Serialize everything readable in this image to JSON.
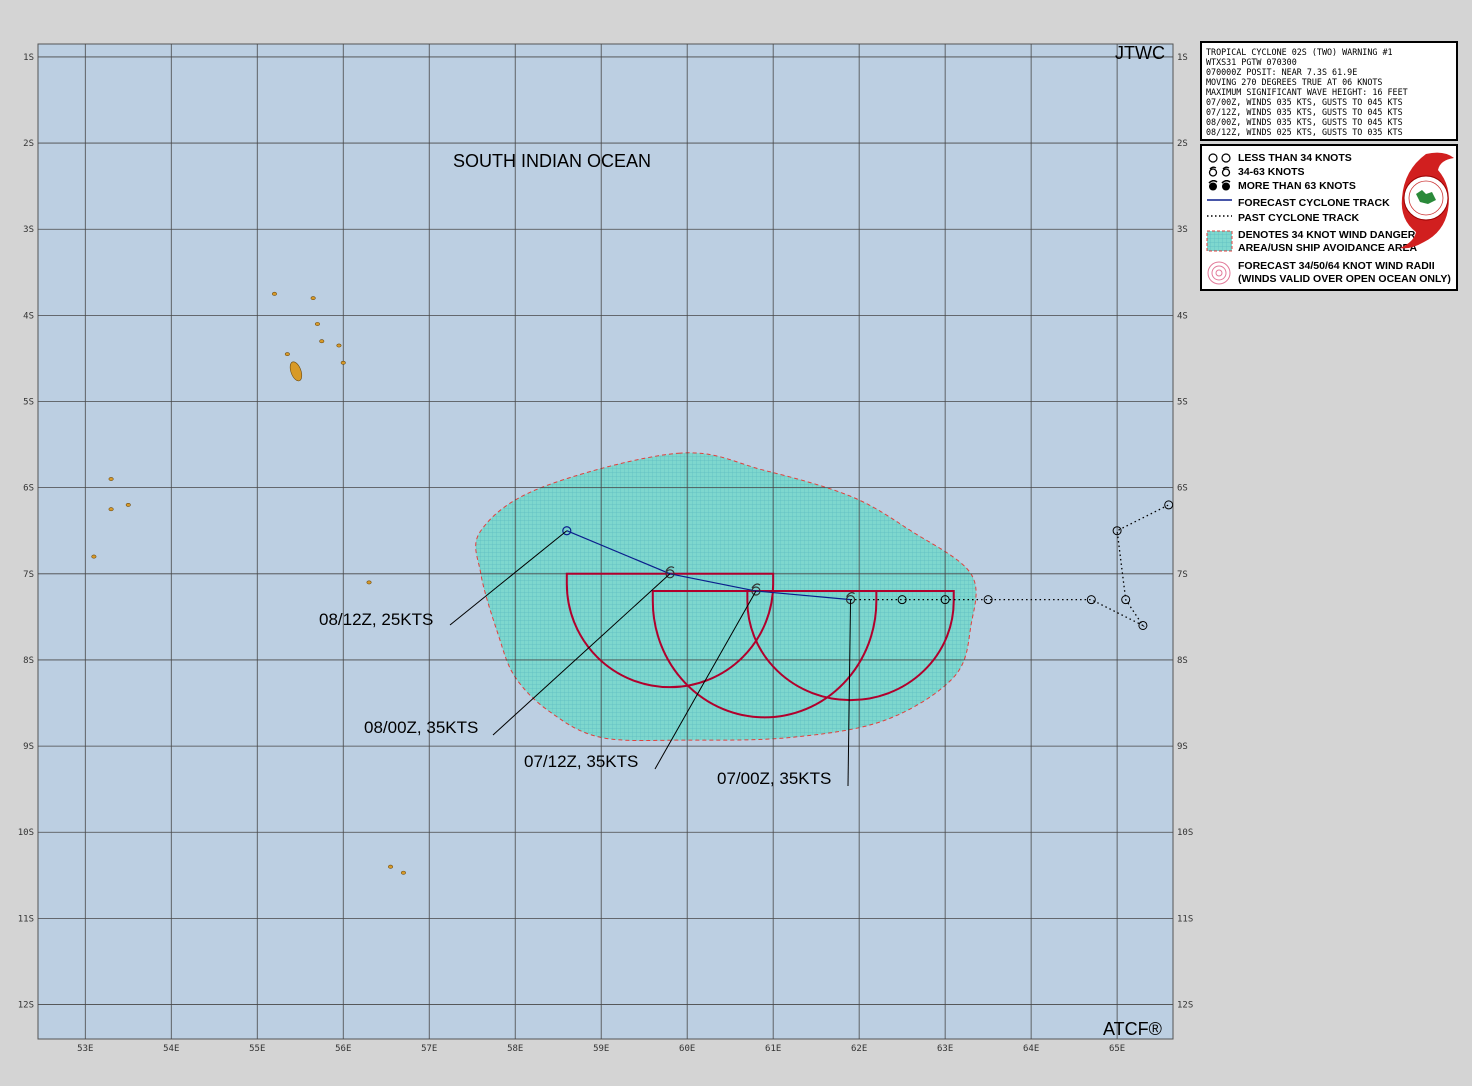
{
  "header": {
    "agency": "JTWC",
    "basin": "SOUTH INDIAN OCEAN",
    "footer": "ATCF®"
  },
  "warning_text": [
    "TROPICAL CYCLONE 02S (TWO) WARNING #1",
    "WTXS31 PGTW 070300",
    "070000Z POSIT: NEAR 7.3S 61.9E",
    "MOVING 270 DEGREES TRUE AT 06 KNOTS",
    "MAXIMUM SIGNIFICANT WAVE HEIGHT: 16 FEET",
    "07/00Z, WINDS 035 KTS, GUSTS TO 045 KTS",
    "07/12Z, WINDS 035 KTS, GUSTS TO 045 KTS",
    "08/00Z, WINDS 035 KTS, GUSTS TO 045 KTS",
    "08/12Z, WINDS 025 KTS, GUSTS TO 035 KTS"
  ],
  "legend": {
    "items": [
      {
        "icon": "hollow-circles-icon",
        "label": "LESS THAN 34 KNOTS"
      },
      {
        "icon": "storm-symbol-icon",
        "label": "34-63 KNOTS"
      },
      {
        "icon": "filled-storm-symbol-icon",
        "label": "MORE THAN 63 KNOTS"
      },
      {
        "icon": "solid-blue-line-icon",
        "label": "FORECAST CYCLONE TRACK"
      },
      {
        "icon": "dotted-line-icon",
        "label": "PAST CYCLONE TRACK"
      },
      {
        "icon": "hatched-area-icon",
        "label": "DENOTES 34 KNOT WIND DANGER"
      },
      {
        "icon": "",
        "label": "AREA/USN SHIP AVOIDANCE AREA"
      },
      {
        "icon": "wind-radii-icon",
        "label": "FORECAST 34/50/64 KNOT WIND RADII"
      },
      {
        "icon": "",
        "label": "(WINDS VALID OVER OPEN OCEAN ONLY)"
      }
    ],
    "logo": "jtwc-seal-icon"
  },
  "axes": {
    "lat_labels": [
      "1S",
      "2S",
      "3S",
      "4S",
      "5S",
      "6S",
      "7S",
      "8S",
      "9S",
      "10S",
      "11S",
      "12S"
    ],
    "lon_labels": [
      "53E",
      "54E",
      "55E",
      "56E",
      "57E",
      "58E",
      "59E",
      "60E",
      "61E",
      "62E",
      "63E",
      "64E",
      "65E"
    ]
  },
  "chart_data": {
    "type": "scatter",
    "map_extent": {
      "lon": [
        52.45,
        65.65
      ],
      "lat": [
        -0.85,
        -12.4
      ]
    },
    "forecast_track": [
      {
        "lon": 61.9,
        "lat": -7.3,
        "label": "07/00Z,  35KTS"
      },
      {
        "lon": 60.8,
        "lat": -7.2,
        "label": "07/12Z,  35KTS"
      },
      {
        "lon": 59.8,
        "lat": -7.0,
        "label": "08/00Z,  35KTS"
      },
      {
        "lon": 58.6,
        "lat": -6.5,
        "label": "08/12Z,  25KTS"
      }
    ],
    "past_track": [
      {
        "lon": 61.9,
        "lat": -7.3
      },
      {
        "lon": 62.5,
        "lat": -7.3
      },
      {
        "lon": 63.0,
        "lat": -7.3
      },
      {
        "lon": 63.5,
        "lat": -7.3
      },
      {
        "lon": 64.7,
        "lat": -7.3
      },
      {
        "lon": 65.3,
        "lat": -7.6
      },
      {
        "lon": 65.1,
        "lat": -7.3
      },
      {
        "lon": 65.0,
        "lat": -6.5
      },
      {
        "lon": 65.6,
        "lat": -6.2
      }
    ],
    "wind_danger_area": [
      [
        59.9,
        -5.6
      ],
      [
        60.9,
        -5.8
      ],
      [
        61.9,
        -6.1
      ],
      [
        62.6,
        -6.5
      ],
      [
        63.3,
        -7.0
      ],
      [
        63.3,
        -7.6
      ],
      [
        63.1,
        -8.2
      ],
      [
        62.3,
        -8.7
      ],
      [
        61.2,
        -8.9
      ],
      [
        60.0,
        -8.93
      ],
      [
        59.0,
        -8.9
      ],
      [
        58.4,
        -8.6
      ],
      [
        58.0,
        -8.2
      ],
      [
        57.8,
        -7.7
      ],
      [
        57.6,
        -7.0
      ],
      [
        57.6,
        -6.5
      ],
      [
        58.3,
        -6.0
      ]
    ],
    "wind_radii": [
      {
        "lon": 61.9,
        "lat": -7.3,
        "east": 1.2,
        "west": 1.2,
        "north": 0.1,
        "south": 1.15
      },
      {
        "lon": 60.8,
        "lat": -7.2,
        "east": 1.4,
        "west": 1.2,
        "north": 0.0,
        "south": 1.35
      },
      {
        "lon": 59.8,
        "lat": -7.0,
        "east": 1.2,
        "west": 1.2,
        "north": 0.0,
        "south": 1.2
      }
    ],
    "islands": [
      [
        55.45,
        -4.65
      ],
      [
        55.35,
        -4.45
      ],
      [
        55.75,
        -4.3
      ],
      [
        55.95,
        -4.35
      ],
      [
        55.7,
        -4.1
      ],
      [
        55.2,
        -3.75
      ],
      [
        55.65,
        -3.8
      ],
      [
        56.0,
        -4.55
      ],
      [
        53.3,
        -5.9
      ],
      [
        53.5,
        -6.2
      ],
      [
        53.3,
        -6.25
      ],
      [
        53.1,
        -6.8
      ],
      [
        56.3,
        -7.1
      ],
      [
        56.55,
        -10.4
      ],
      [
        56.7,
        -10.47
      ]
    ],
    "colors": {
      "ocean": "#bccfe2",
      "grid": "#474747",
      "track": "#0b1e8c",
      "radii": "#b1002c",
      "danger_fill": "#7ed7ce",
      "danger_edge": "#e2403c",
      "land": "#d89a28"
    }
  }
}
